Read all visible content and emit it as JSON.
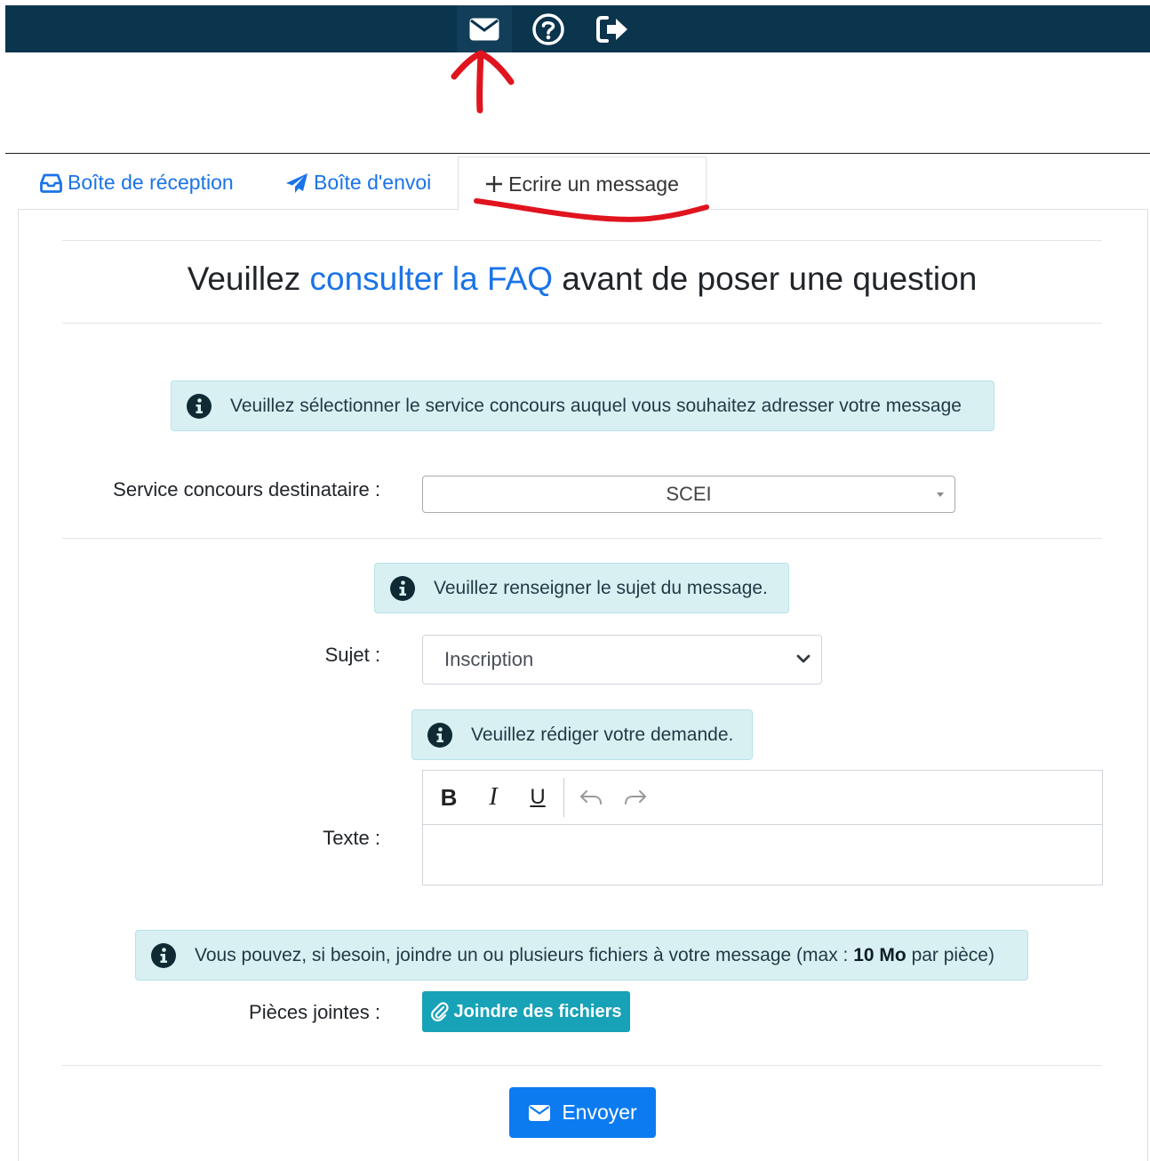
{
  "topbar": {
    "icons": [
      "envelope-icon",
      "question-circle-icon",
      "sign-out-icon"
    ]
  },
  "tabs": {
    "inbox": "Boîte de réception",
    "sent": "Boîte d'envoi",
    "compose": "Ecrire un message"
  },
  "heading": {
    "pre": "Veuillez ",
    "link": "consulter la FAQ",
    "post": " avant de poser une question"
  },
  "alerts": {
    "service": "Veuillez sélectionner le service concours auquel vous souhaitez adresser votre message",
    "subject": "Veuillez renseigner le sujet du message.",
    "text": "Veuillez rédiger votre demande.",
    "files_pre": "Vous pouvez, si besoin, joindre un ou plusieurs fichiers à votre message (max : ",
    "files_bold": "10 Mo",
    "files_post": " par pièce)"
  },
  "form": {
    "service_label": "Service concours destinataire :",
    "service_value": "SCEI",
    "subject_label": "Sujet :",
    "subject_value": "Inscription",
    "text_label": "Texte :",
    "attachments_label": "Pièces jointes :",
    "attach_button": "Joindre des fichiers",
    "send_button": "Envoyer"
  },
  "editor_toolbar": {
    "bold": "B",
    "italic": "I",
    "underline": "U"
  },
  "colors": {
    "topbar": "#0b344d",
    "link": "#1a73e8",
    "info_bg": "#d9f0f3",
    "attach": "#17a2b8",
    "send": "#0d7bf0",
    "annotation": "#e0141e"
  }
}
